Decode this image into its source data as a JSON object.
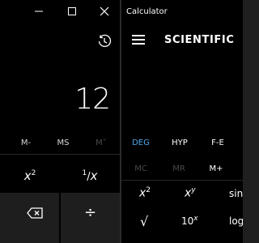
{
  "left_window": {
    "display_value": "12",
    "memory_buttons": [
      "M-",
      "MS",
      "M˅"
    ],
    "functions": {
      "square": {
        "base": "x",
        "exp": "2"
      },
      "reciprocal": {
        "num": "1",
        "den": "x"
      }
    },
    "bottom_keys": {
      "divide": "÷"
    },
    "icons": [
      "minimize-icon",
      "maximize-icon",
      "close-icon",
      "history-icon",
      "backspace-icon"
    ]
  },
  "right_window": {
    "app_title": "Calculator",
    "mode_title": "SCIENTIFIC",
    "options": [
      "DEG",
      "HYP",
      "F-E"
    ],
    "memory_buttons": [
      "MC",
      "MR",
      "M+"
    ],
    "functions_row1": {
      "x2": {
        "base": "x",
        "exp": "2"
      },
      "xy": {
        "base": "x",
        "exp": "y"
      },
      "sin": "sin"
    },
    "functions_row2": {
      "sqrt": "√",
      "ten_x": {
        "base": "10",
        "exp": "x"
      },
      "log": "log"
    }
  },
  "colors": {
    "accent": "#4fa6e8",
    "background": "#000000",
    "tile_dark": "#1e1e1e"
  }
}
